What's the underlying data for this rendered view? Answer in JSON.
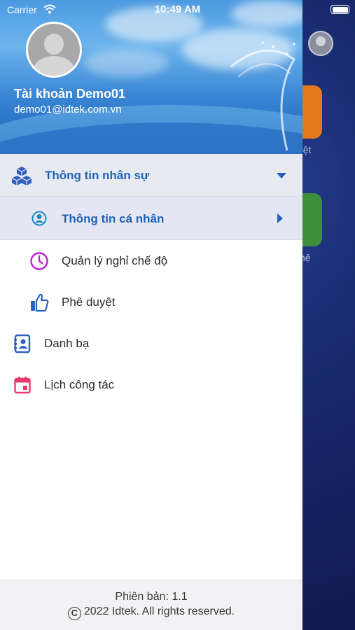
{
  "status_bar": {
    "carrier": "Carrier",
    "time": "10:49 AM"
  },
  "profile": {
    "name": "Tài khoản Demo01",
    "email": "demo01@idtek.com.vn"
  },
  "menu": {
    "group": {
      "label": "Thông tin nhân sự",
      "icon": "cubes-icon",
      "expanded": true
    },
    "sub_items": [
      {
        "label": "Thông tin cá nhân",
        "icon": "person-circle-icon",
        "active": true
      },
      {
        "label": "Quản lý nghỉ chế độ",
        "icon": "clock-icon",
        "active": false
      },
      {
        "label": "Phê duyệt",
        "icon": "thumbs-up-icon",
        "active": false
      }
    ],
    "items": [
      {
        "label": "Danh bạ",
        "icon": "contacts-book-icon"
      },
      {
        "label": "Lịch công tác",
        "icon": "calendar-icon"
      }
    ]
  },
  "footer": {
    "version": "Phiên bản: 1.1",
    "copyright": "2022 Idtek. All rights reserved."
  },
  "background_app": {
    "tile_label_1": "uyệt",
    "tile_label_2": "hệ"
  },
  "colors": {
    "accent": "#1f63b8",
    "active_row_bg": "#e4e7f3",
    "group_row_bg": "#e8eaf1",
    "clock_icon": "#c020d8",
    "calendar_icon": "#e83a6e",
    "person_icon": "#1b87c2",
    "thumb_icon": "#2f5fbf"
  }
}
